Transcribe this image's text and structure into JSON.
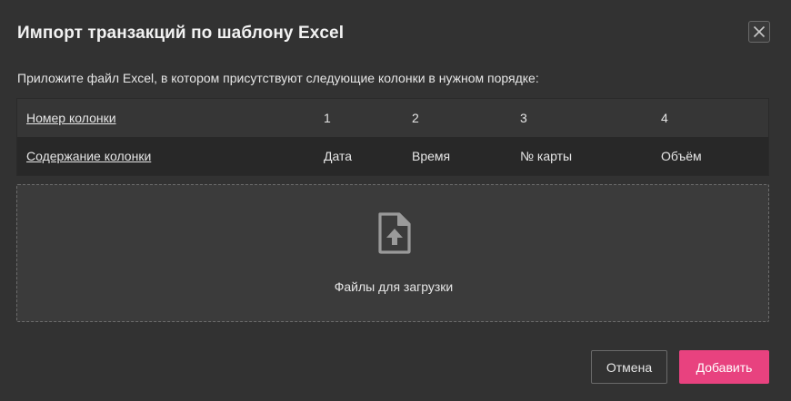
{
  "dialog": {
    "title": "Импорт транзакций по шаблону Excel",
    "instruction": "Приложите файл Excel, в котором присутствуют следующие колонки в нужном порядке:"
  },
  "columns_table": {
    "rows": [
      {
        "label": "Номер колонки",
        "cells": [
          "1",
          "2",
          "3",
          "4"
        ]
      },
      {
        "label": "Содержание колонки",
        "cells": [
          "Дата",
          "Время",
          "№ карты",
          "Объём"
        ]
      }
    ]
  },
  "dropzone": {
    "icon": "file-upload-icon",
    "label": "Файлы для загрузки"
  },
  "actions": {
    "cancel_label": "Отмена",
    "add_label": "Добавить"
  },
  "colors": {
    "background": "#323232",
    "accent": "#e8427f",
    "text": "#e6e6e6"
  }
}
